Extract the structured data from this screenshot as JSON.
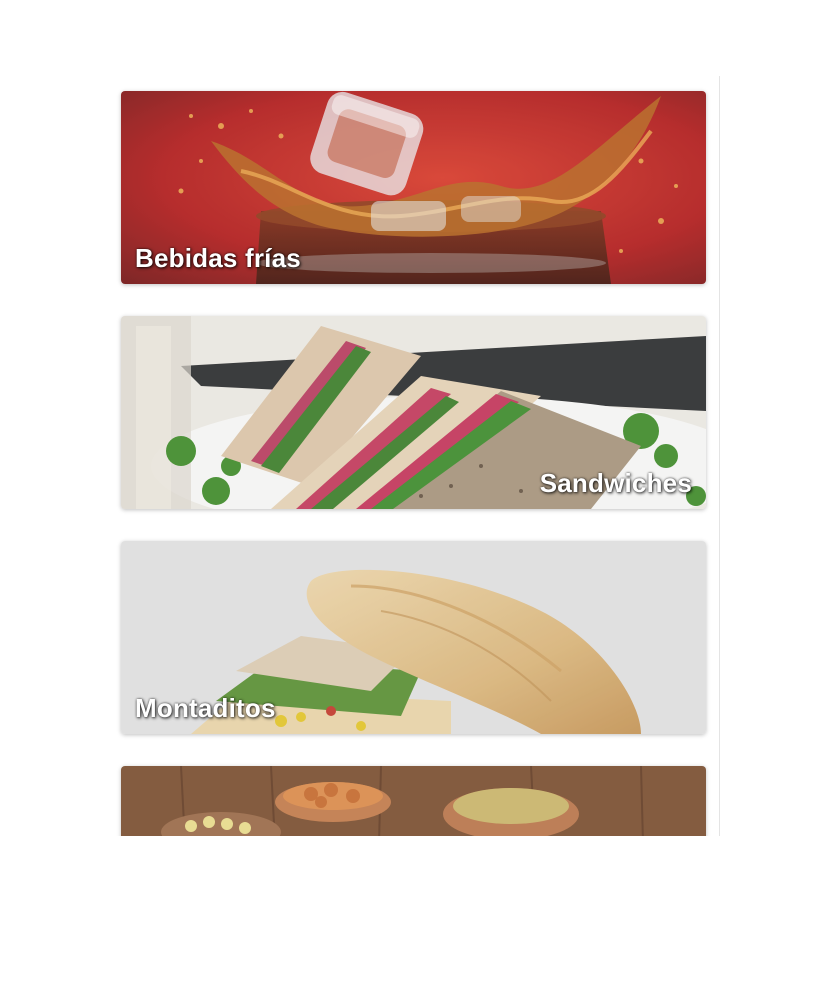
{
  "categories": [
    {
      "label": "Bebidas frías",
      "label_position": "left",
      "photo_icon": "cold-drink-photo"
    },
    {
      "label": "Sandwiches",
      "label_position": "right",
      "photo_icon": "sandwich-photo"
    },
    {
      "label": "Montaditos",
      "label_position": "left",
      "photo_icon": "baguette-photo"
    },
    {
      "label": "",
      "label_position": "left",
      "photo_icon": "tapas-photo"
    }
  ]
}
